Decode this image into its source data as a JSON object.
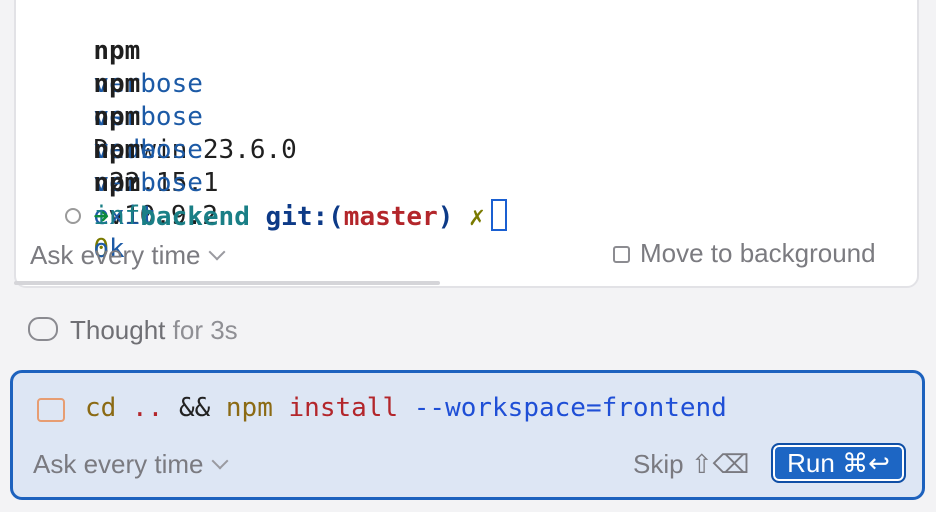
{
  "terminal": {
    "lines": [
      {
        "prefix": "npm",
        "verb": "verbose",
        "key": "os",
        "value": "Darwin 23.6.0"
      },
      {
        "prefix": "npm",
        "verb": "verbose",
        "key": "node",
        "value": "v22.15.1"
      },
      {
        "prefix": "npm",
        "verb": "verbose",
        "key": "npm",
        "value": "v10.9.2"
      },
      {
        "prefix": "npm",
        "verb": "verbose",
        "key": "exit",
        "value": "0"
      },
      {
        "prefix": "npm",
        "verb": "info",
        "key": "ok",
        "value": ""
      }
    ],
    "prompt": {
      "arrow": "➜",
      "folder": "backend",
      "git_label": "git:(",
      "branch": "master",
      "git_close": ")",
      "dirty": "✗"
    },
    "footer": {
      "ask_label": "Ask every time",
      "move_label": "Move to background"
    }
  },
  "thought": {
    "label": "Thought",
    "duration": "for 3s"
  },
  "command": {
    "cd": "cd",
    "dots": "..",
    "and": "&&",
    "npm": "npm",
    "install": "install",
    "flag": "--workspace=frontend",
    "ask_label": "Ask every time",
    "skip_label": "Skip",
    "skip_shortcut": "⇧⌫",
    "run_label": "Run",
    "run_shortcut": "⌘↩"
  }
}
